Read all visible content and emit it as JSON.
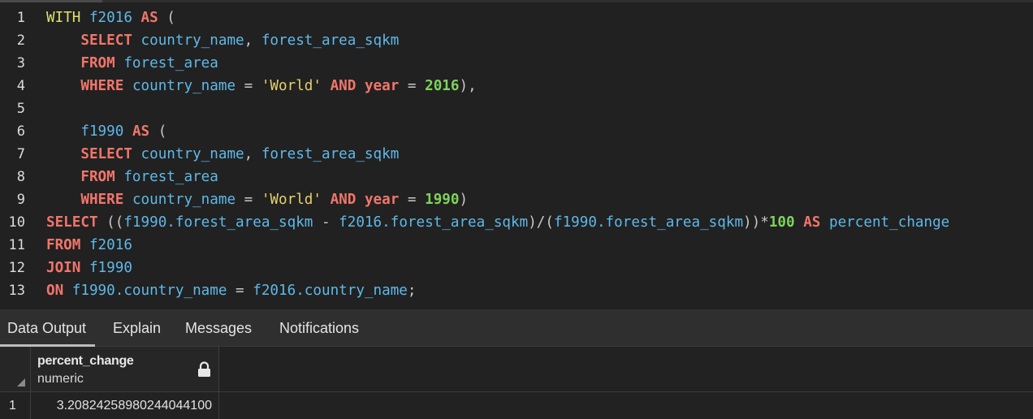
{
  "editor": {
    "line_numbers": [
      "1",
      "2",
      "3",
      "4",
      "5",
      "6",
      "7",
      "8",
      "9",
      "10",
      "11",
      "12",
      "13"
    ],
    "lines": [
      [
        {
          "t": "WITH",
          "c": "kwy"
        },
        {
          "t": " ",
          "c": "op"
        },
        {
          "t": "f2016",
          "c": "id"
        },
        {
          "t": " ",
          "c": "op"
        },
        {
          "t": "AS",
          "c": "kw"
        },
        {
          "t": " (",
          "c": "op"
        }
      ],
      [
        {
          "t": "    ",
          "c": "op"
        },
        {
          "t": "SELECT",
          "c": "kw"
        },
        {
          "t": " ",
          "c": "op"
        },
        {
          "t": "country_name",
          "c": "id"
        },
        {
          "t": ", ",
          "c": "op"
        },
        {
          "t": "forest_area_sqkm",
          "c": "id"
        }
      ],
      [
        {
          "t": "    ",
          "c": "op"
        },
        {
          "t": "FROM",
          "c": "kw"
        },
        {
          "t": " ",
          "c": "op"
        },
        {
          "t": "forest_area",
          "c": "id"
        }
      ],
      [
        {
          "t": "    ",
          "c": "op"
        },
        {
          "t": "WHERE",
          "c": "kw"
        },
        {
          "t": " ",
          "c": "op"
        },
        {
          "t": "country_name",
          "c": "id"
        },
        {
          "t": " = ",
          "c": "op"
        },
        {
          "t": "'World'",
          "c": "str"
        },
        {
          "t": " ",
          "c": "op"
        },
        {
          "t": "AND",
          "c": "kw"
        },
        {
          "t": " ",
          "c": "op"
        },
        {
          "t": "year",
          "c": "kw"
        },
        {
          "t": " = ",
          "c": "op"
        },
        {
          "t": "2016",
          "c": "num"
        },
        {
          "t": "),",
          "c": "op"
        }
      ],
      [
        {
          "t": "",
          "c": "op"
        }
      ],
      [
        {
          "t": "    ",
          "c": "op"
        },
        {
          "t": "f1990",
          "c": "id"
        },
        {
          "t": " ",
          "c": "op"
        },
        {
          "t": "AS",
          "c": "kw"
        },
        {
          "t": " (",
          "c": "op"
        }
      ],
      [
        {
          "t": "    ",
          "c": "op"
        },
        {
          "t": "SELECT",
          "c": "kw"
        },
        {
          "t": " ",
          "c": "op"
        },
        {
          "t": "country_name",
          "c": "id"
        },
        {
          "t": ", ",
          "c": "op"
        },
        {
          "t": "forest_area_sqkm",
          "c": "id"
        }
      ],
      [
        {
          "t": "    ",
          "c": "op"
        },
        {
          "t": "FROM",
          "c": "kw"
        },
        {
          "t": " ",
          "c": "op"
        },
        {
          "t": "forest_area",
          "c": "id"
        }
      ],
      [
        {
          "t": "    ",
          "c": "op"
        },
        {
          "t": "WHERE",
          "c": "kw"
        },
        {
          "t": " ",
          "c": "op"
        },
        {
          "t": "country_name",
          "c": "id"
        },
        {
          "t": " = ",
          "c": "op"
        },
        {
          "t": "'World'",
          "c": "str"
        },
        {
          "t": " ",
          "c": "op"
        },
        {
          "t": "AND",
          "c": "kw"
        },
        {
          "t": " ",
          "c": "op"
        },
        {
          "t": "year",
          "c": "kw"
        },
        {
          "t": " = ",
          "c": "op"
        },
        {
          "t": "1990",
          "c": "num"
        },
        {
          "t": ")",
          "c": "op"
        }
      ],
      [
        {
          "t": "SELECT",
          "c": "kw"
        },
        {
          "t": " ((",
          "c": "op"
        },
        {
          "t": "f1990.forest_area_sqkm",
          "c": "id"
        },
        {
          "t": " - ",
          "c": "op"
        },
        {
          "t": "f2016.forest_area_sqkm",
          "c": "id"
        },
        {
          "t": ")/(",
          "c": "op"
        },
        {
          "t": "f1990.forest_area_sqkm",
          "c": "id"
        },
        {
          "t": "))*",
          "c": "op"
        },
        {
          "t": "100",
          "c": "num"
        },
        {
          "t": " ",
          "c": "op"
        },
        {
          "t": "AS",
          "c": "kw"
        },
        {
          "t": " ",
          "c": "op"
        },
        {
          "t": "percent_change",
          "c": "id"
        }
      ],
      [
        {
          "t": "FROM",
          "c": "kw"
        },
        {
          "t": " ",
          "c": "op"
        },
        {
          "t": "f2016",
          "c": "id"
        }
      ],
      [
        {
          "t": "JOIN",
          "c": "kw"
        },
        {
          "t": " ",
          "c": "op"
        },
        {
          "t": "f1990",
          "c": "id"
        }
      ],
      [
        {
          "t": "ON",
          "c": "kw"
        },
        {
          "t": " ",
          "c": "op"
        },
        {
          "t": "f1990.country_name",
          "c": "id"
        },
        {
          "t": " = ",
          "c": "op"
        },
        {
          "t": "f2016.country_name",
          "c": "id"
        },
        {
          "t": ";",
          "c": "op"
        }
      ]
    ]
  },
  "tabs": {
    "data_output": "Data Output",
    "explain": "Explain",
    "messages": "Messages",
    "notifications": "Notifications",
    "active": "Data Output"
  },
  "grid": {
    "columns": [
      {
        "name": "percent_change",
        "type": "numeric",
        "icon": "lock-icon"
      }
    ],
    "rows": [
      {
        "row_number": "1",
        "values": [
          "3.20824258980244044100"
        ]
      }
    ]
  }
}
